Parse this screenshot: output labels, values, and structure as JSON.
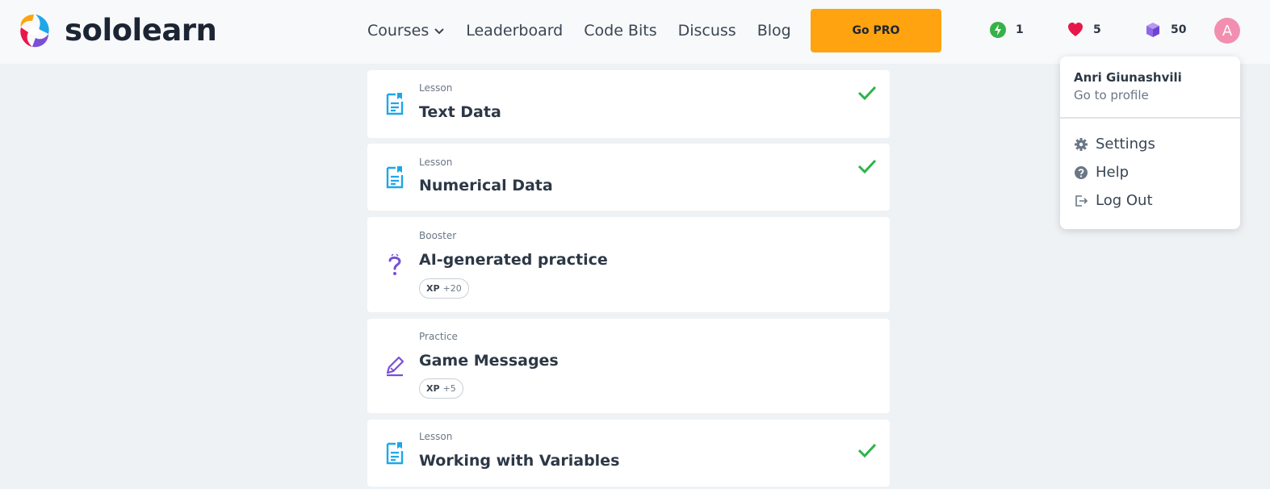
{
  "header": {
    "logo_text": "sololearn",
    "nav": [
      {
        "label": "Courses",
        "has_dropdown": true
      },
      {
        "label": "Leaderboard"
      },
      {
        "label": "Code Bits"
      },
      {
        "label": "Discuss"
      },
      {
        "label": "Blog"
      }
    ],
    "go_pro_label": "Go PRO",
    "stats": {
      "streak": "1",
      "hearts": "5",
      "bits": "50"
    },
    "avatar_letter": "A"
  },
  "lessons": [
    {
      "kind": "Lesson",
      "title": "Text Data",
      "icon": "lesson-document-icon",
      "completed": true
    },
    {
      "kind": "Lesson",
      "title": "Numerical Data",
      "icon": "lesson-document-icon",
      "completed": true
    },
    {
      "kind": "Booster",
      "title": "AI-generated practice",
      "icon": "question-mark-icon",
      "completed": false,
      "xp_label": "XP",
      "xp_value": "+20"
    },
    {
      "kind": "Practice",
      "title": "Game Messages",
      "icon": "pencil-icon",
      "completed": false,
      "xp_label": "XP",
      "xp_value": "+5"
    },
    {
      "kind": "Lesson",
      "title": "Working with Variables",
      "icon": "lesson-document-icon",
      "completed": true
    }
  ],
  "profile_menu": {
    "user_name": "Anri Giunashvili",
    "profile_link": "Go to profile",
    "items": [
      {
        "label": "Settings",
        "icon": "gear-icon"
      },
      {
        "label": "Help",
        "icon": "help-icon"
      },
      {
        "label": "Log Out",
        "icon": "logout-icon"
      }
    ]
  },
  "colors": {
    "accent_orange": "#ffa310",
    "lesson_blue": "#1ea7e8",
    "purple": "#7a4fd6",
    "check_green": "#2db34a",
    "heart_red": "#e8174a",
    "streak_green": "#36b149"
  }
}
